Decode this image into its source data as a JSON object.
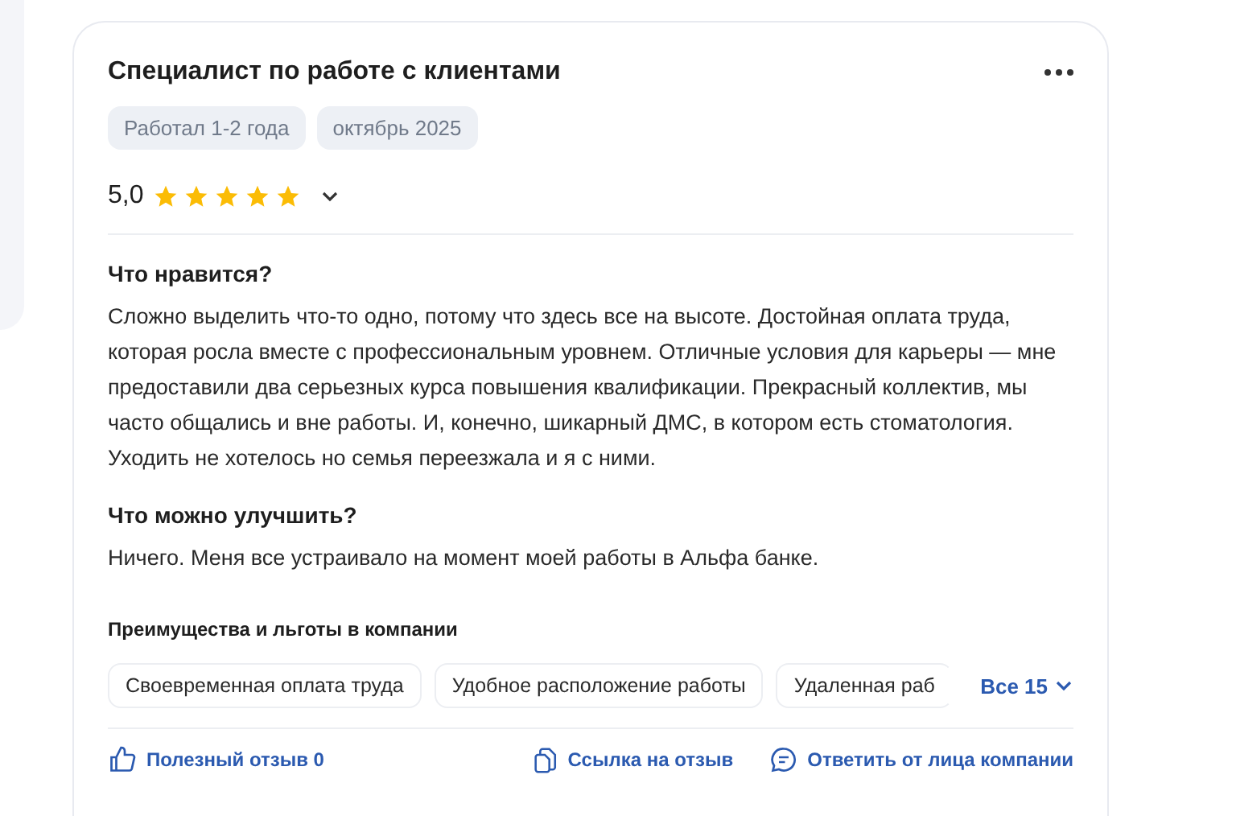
{
  "review": {
    "title": "Специалист по работе с клиентами",
    "tags": [
      "Работал 1-2 года",
      "октябрь 2025"
    ],
    "rating": "5,0",
    "stars": 5,
    "sections": [
      {
        "heading": "Что нравится?",
        "text": "Сложно выделить что-то одно, потому что здесь все на высоте. Достойная оплата труда, которая росла вместе с профессиональным уровнем. Отличные условия для карьеры — мне предоставили два серьезных курса повышения квалификации. Прекрасный коллектив, мы часто общались и вне работы. И, конечно, шикарный ДМС, в котором есть стоматология. Уходить не хотелось но семья переезжала и я с ними."
      },
      {
        "heading": "Что можно улучшить?",
        "text": "Ничего. Меня все устраивало на момент моей работы в Альфа банке."
      }
    ],
    "benefits_title": "Преимущества и льготы в компании",
    "benefits": [
      "Своевременная оплата труда",
      "Удобное расположение работы",
      "Удаленная раб"
    ],
    "all_benefits": "Все 15",
    "actions": [
      {
        "kind": "like",
        "label": "Полезный отзыв 0"
      },
      {
        "kind": "link",
        "label": "Ссылка на отзыв"
      },
      {
        "kind": "reply",
        "label": "Ответить от лица компании"
      }
    ]
  }
}
